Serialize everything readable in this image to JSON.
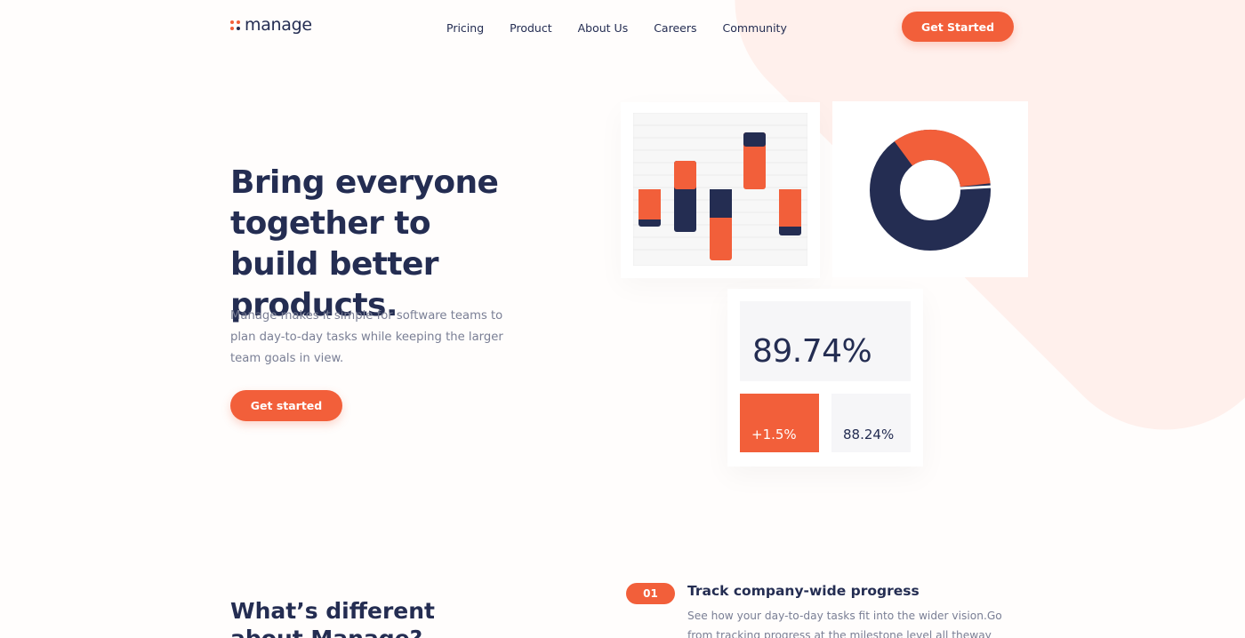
{
  "colors": {
    "accent": "#f25f3a",
    "navy": "#242d52",
    "muted_text": "#7a7f95",
    "accent_light_bg": "#fff0ec"
  },
  "header": {
    "logo_text": "manage",
    "nav": [
      {
        "label": "Pricing"
      },
      {
        "label": "Product"
      },
      {
        "label": "About Us"
      },
      {
        "label": "Careers"
      },
      {
        "label": "Community"
      }
    ],
    "cta_label": "Get Started"
  },
  "hero": {
    "title": "Bring everyone together to build better products.",
    "description": "Manage makes it simple for software teams to plan day-to-day tasks while keeping the larger team goals in view.",
    "cta_label": "Get started"
  },
  "stats": {
    "main_value": "89.74%",
    "change_value": "+1.5%",
    "secondary_value": "88.24%"
  },
  "features": {
    "section_title": "What’s different about Manage?",
    "items": [
      {
        "number": "01",
        "title": "Track company-wide progress",
        "description": "See how your day-to-day tasks fit into the wider vision.Go from tracking progress at the milestone level all theway done to the"
      }
    ]
  }
}
